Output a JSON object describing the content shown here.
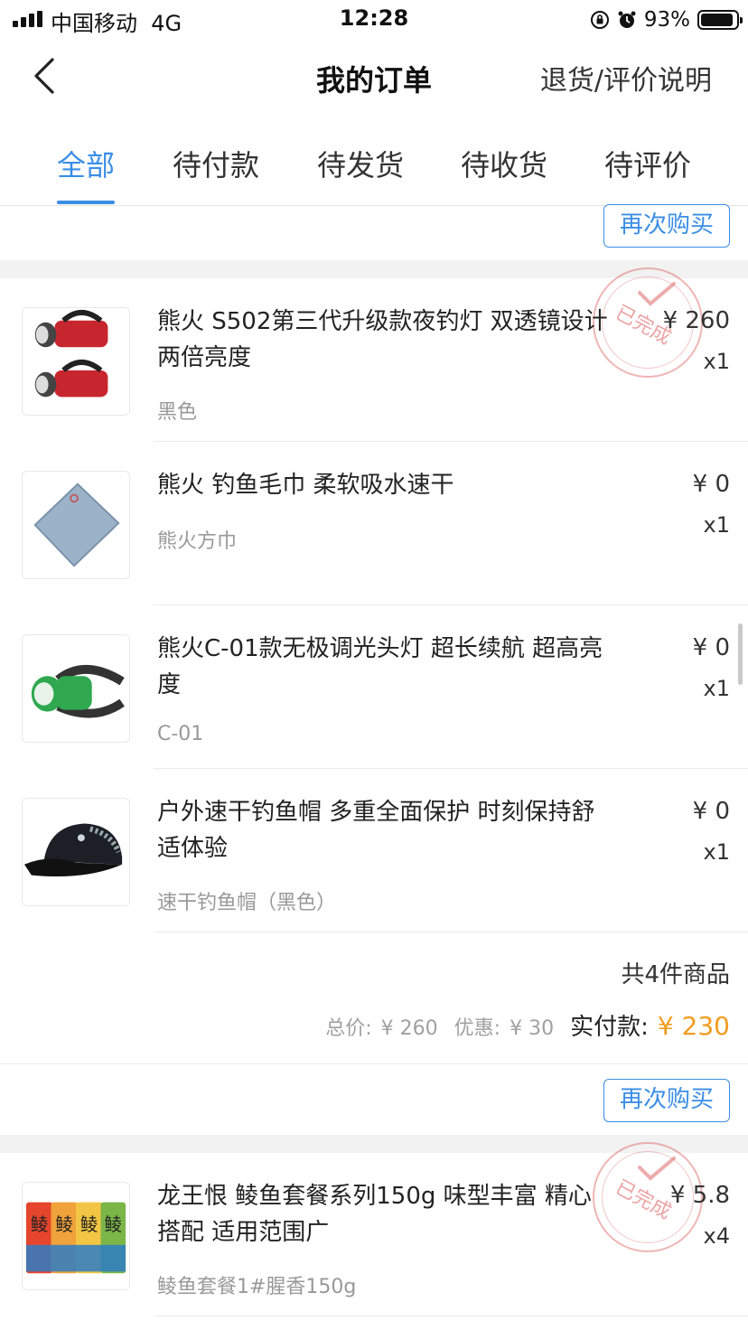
{
  "status_bar": {
    "carrier": "中国移动",
    "network": "4G",
    "time": "12:28",
    "battery": "93%"
  },
  "nav": {
    "title": "我的订单",
    "help_link": "退货/评价说明"
  },
  "tabs": [
    "全部",
    "待付款",
    "待发货",
    "待收货",
    "待评价"
  ],
  "active_tab": "全部",
  "colors": {
    "accent": "#3a8ee6",
    "price_highlight": "#f39c1f",
    "stamp": "#dc5a5a"
  },
  "order_top": {
    "rebuy_label": "再次购买"
  },
  "order1": {
    "status_stamp": "已完成",
    "items": [
      {
        "title": "熊火 S502第三代升级款夜钓灯 双透镜设计 两倍亮度",
        "spec": "黑色",
        "price": "¥ 260",
        "qty": "x1",
        "icon": "fishing-lamp-image"
      },
      {
        "title": "熊火 钓鱼毛巾 柔软吸水速干",
        "spec": "熊火方巾",
        "price": "¥ 0",
        "qty": "x1",
        "icon": "towel-image"
      },
      {
        "title": "熊火C-01款无极调光头灯  超长续航 超高亮度",
        "spec": "C-01",
        "price": "¥ 0",
        "qty": "x1",
        "icon": "headlamp-image"
      },
      {
        "title": "户外速干钓鱼帽 多重全面保护 时刻保持舒适体验",
        "spec": "速干钓鱼帽（黑色）",
        "price": "¥ 0",
        "qty": "x1",
        "icon": "cap-image"
      }
    ],
    "total_count": "共4件商品",
    "total_label": "总价:",
    "total_value": "¥ 260",
    "discount_label": "优惠:",
    "discount_value": "¥ 30",
    "paid_label": "实付款:",
    "paid_value": "¥ 230",
    "rebuy_label": "再次购买"
  },
  "order2": {
    "status_stamp": "已完成",
    "items": [
      {
        "title": "龙王恨 鲮鱼套餐系列150g 味型丰富 精心搭配 适用范围广",
        "spec": "鲮鱼套餐1#腥香150g",
        "price": "¥ 5.8",
        "qty": "x4",
        "icon": "bait-packs-image",
        "pack_labels": [
          "鲮",
          "鲮",
          "鲮",
          "鲮"
        ]
      }
    ]
  }
}
